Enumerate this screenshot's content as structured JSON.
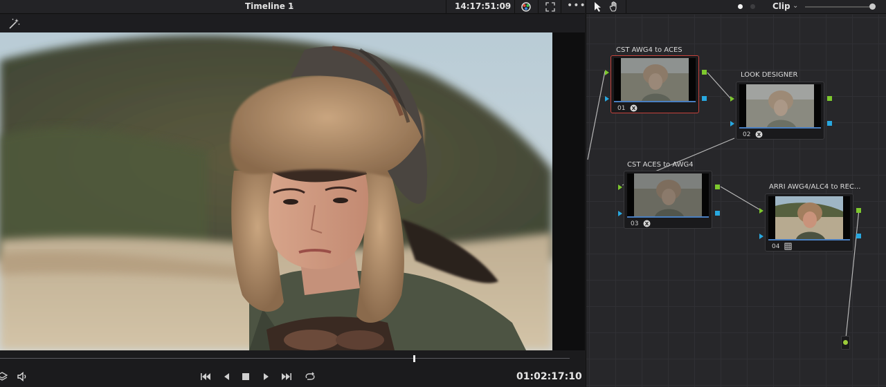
{
  "viewer": {
    "timeline_title": "Timeline 1",
    "timecode_top": "14:17:51:09",
    "timecode_bottom": "01:02:17:10",
    "playhead_fraction": 0.727
  },
  "node_editor": {
    "mode_label": "Clip",
    "nodes": [
      {
        "label": "CST AWG4 to ACES",
        "number": "01",
        "badge": "clip-icon",
        "selected": true
      },
      {
        "label": "LOOK DESIGNER",
        "number": "02",
        "badge": "clip-icon",
        "selected": false
      },
      {
        "label": "CST ACES to AWG4",
        "number": "03",
        "badge": "clip-icon",
        "selected": false
      },
      {
        "label": "ARRI AWG4/ALC4 to REC...",
        "number": "04",
        "badge": "grid-icon",
        "selected": false
      }
    ]
  },
  "colors": {
    "selected_node_border": "#c8433c",
    "port_green": "#7dc82e",
    "port_blue": "#28a8e0",
    "node_bar": "#4a7fc1"
  }
}
